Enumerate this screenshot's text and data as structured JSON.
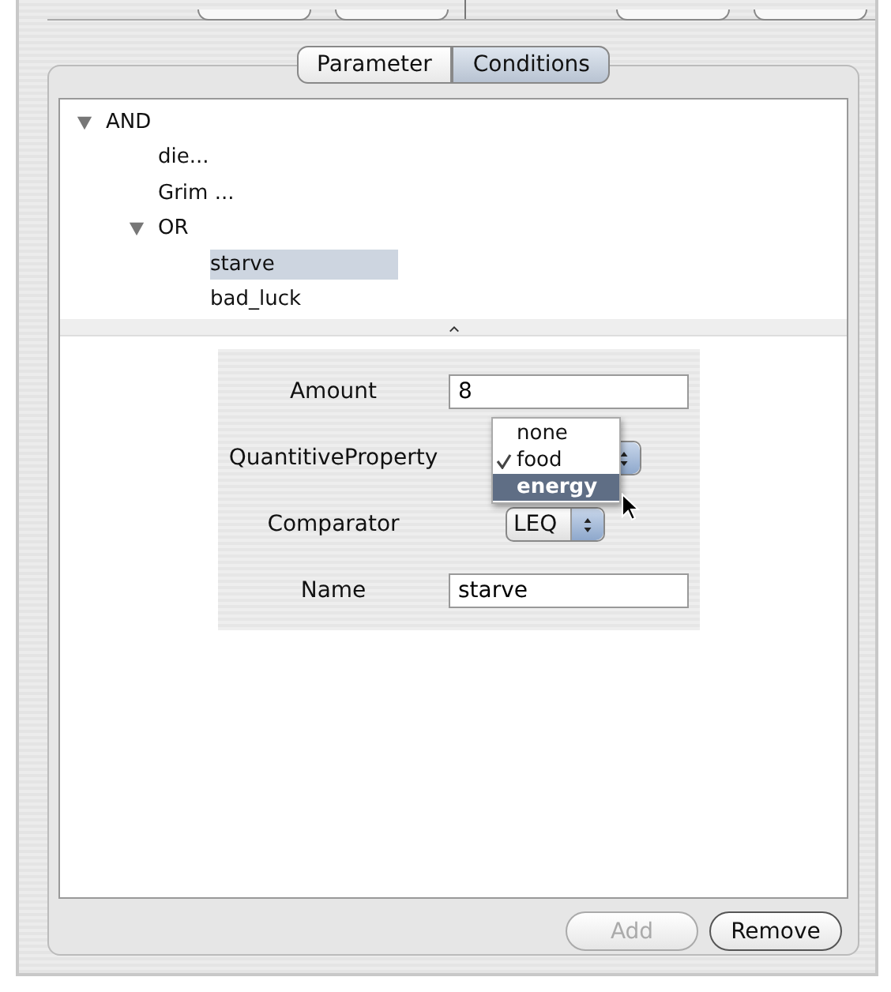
{
  "tabs": [
    {
      "label": "Parameter",
      "selected": false
    },
    {
      "label": "Conditions",
      "selected": true
    }
  ],
  "tree": [
    {
      "label": "AND",
      "expanded": true,
      "selected": false,
      "children": [
        {
          "label": "die...",
          "selected": false
        },
        {
          "label": "Grim ...",
          "selected": false
        },
        {
          "label": "OR",
          "expanded": true,
          "selected": false,
          "children": [
            {
              "label": "starve",
              "selected": true
            },
            {
              "label": "bad_luck",
              "selected": false
            }
          ]
        }
      ]
    }
  ],
  "fields": [
    {
      "kind": "text",
      "label": "Amount",
      "value": "8"
    },
    {
      "kind": "popup",
      "label": "QuantitiveProperty",
      "menu": [
        {
          "label": "none",
          "checked": false,
          "selected": false
        },
        {
          "label": "food",
          "checked": true,
          "selected": false
        },
        {
          "label": "energy",
          "checked": false,
          "selected": true
        }
      ]
    },
    {
      "kind": "popup",
      "label": "Comparator",
      "value": "LEQ"
    },
    {
      "kind": "text",
      "label": "Name",
      "value": "starve"
    }
  ],
  "buttons": [
    {
      "label": "Add",
      "disabled": true
    },
    {
      "label": "Remove",
      "disabled": false
    }
  ]
}
